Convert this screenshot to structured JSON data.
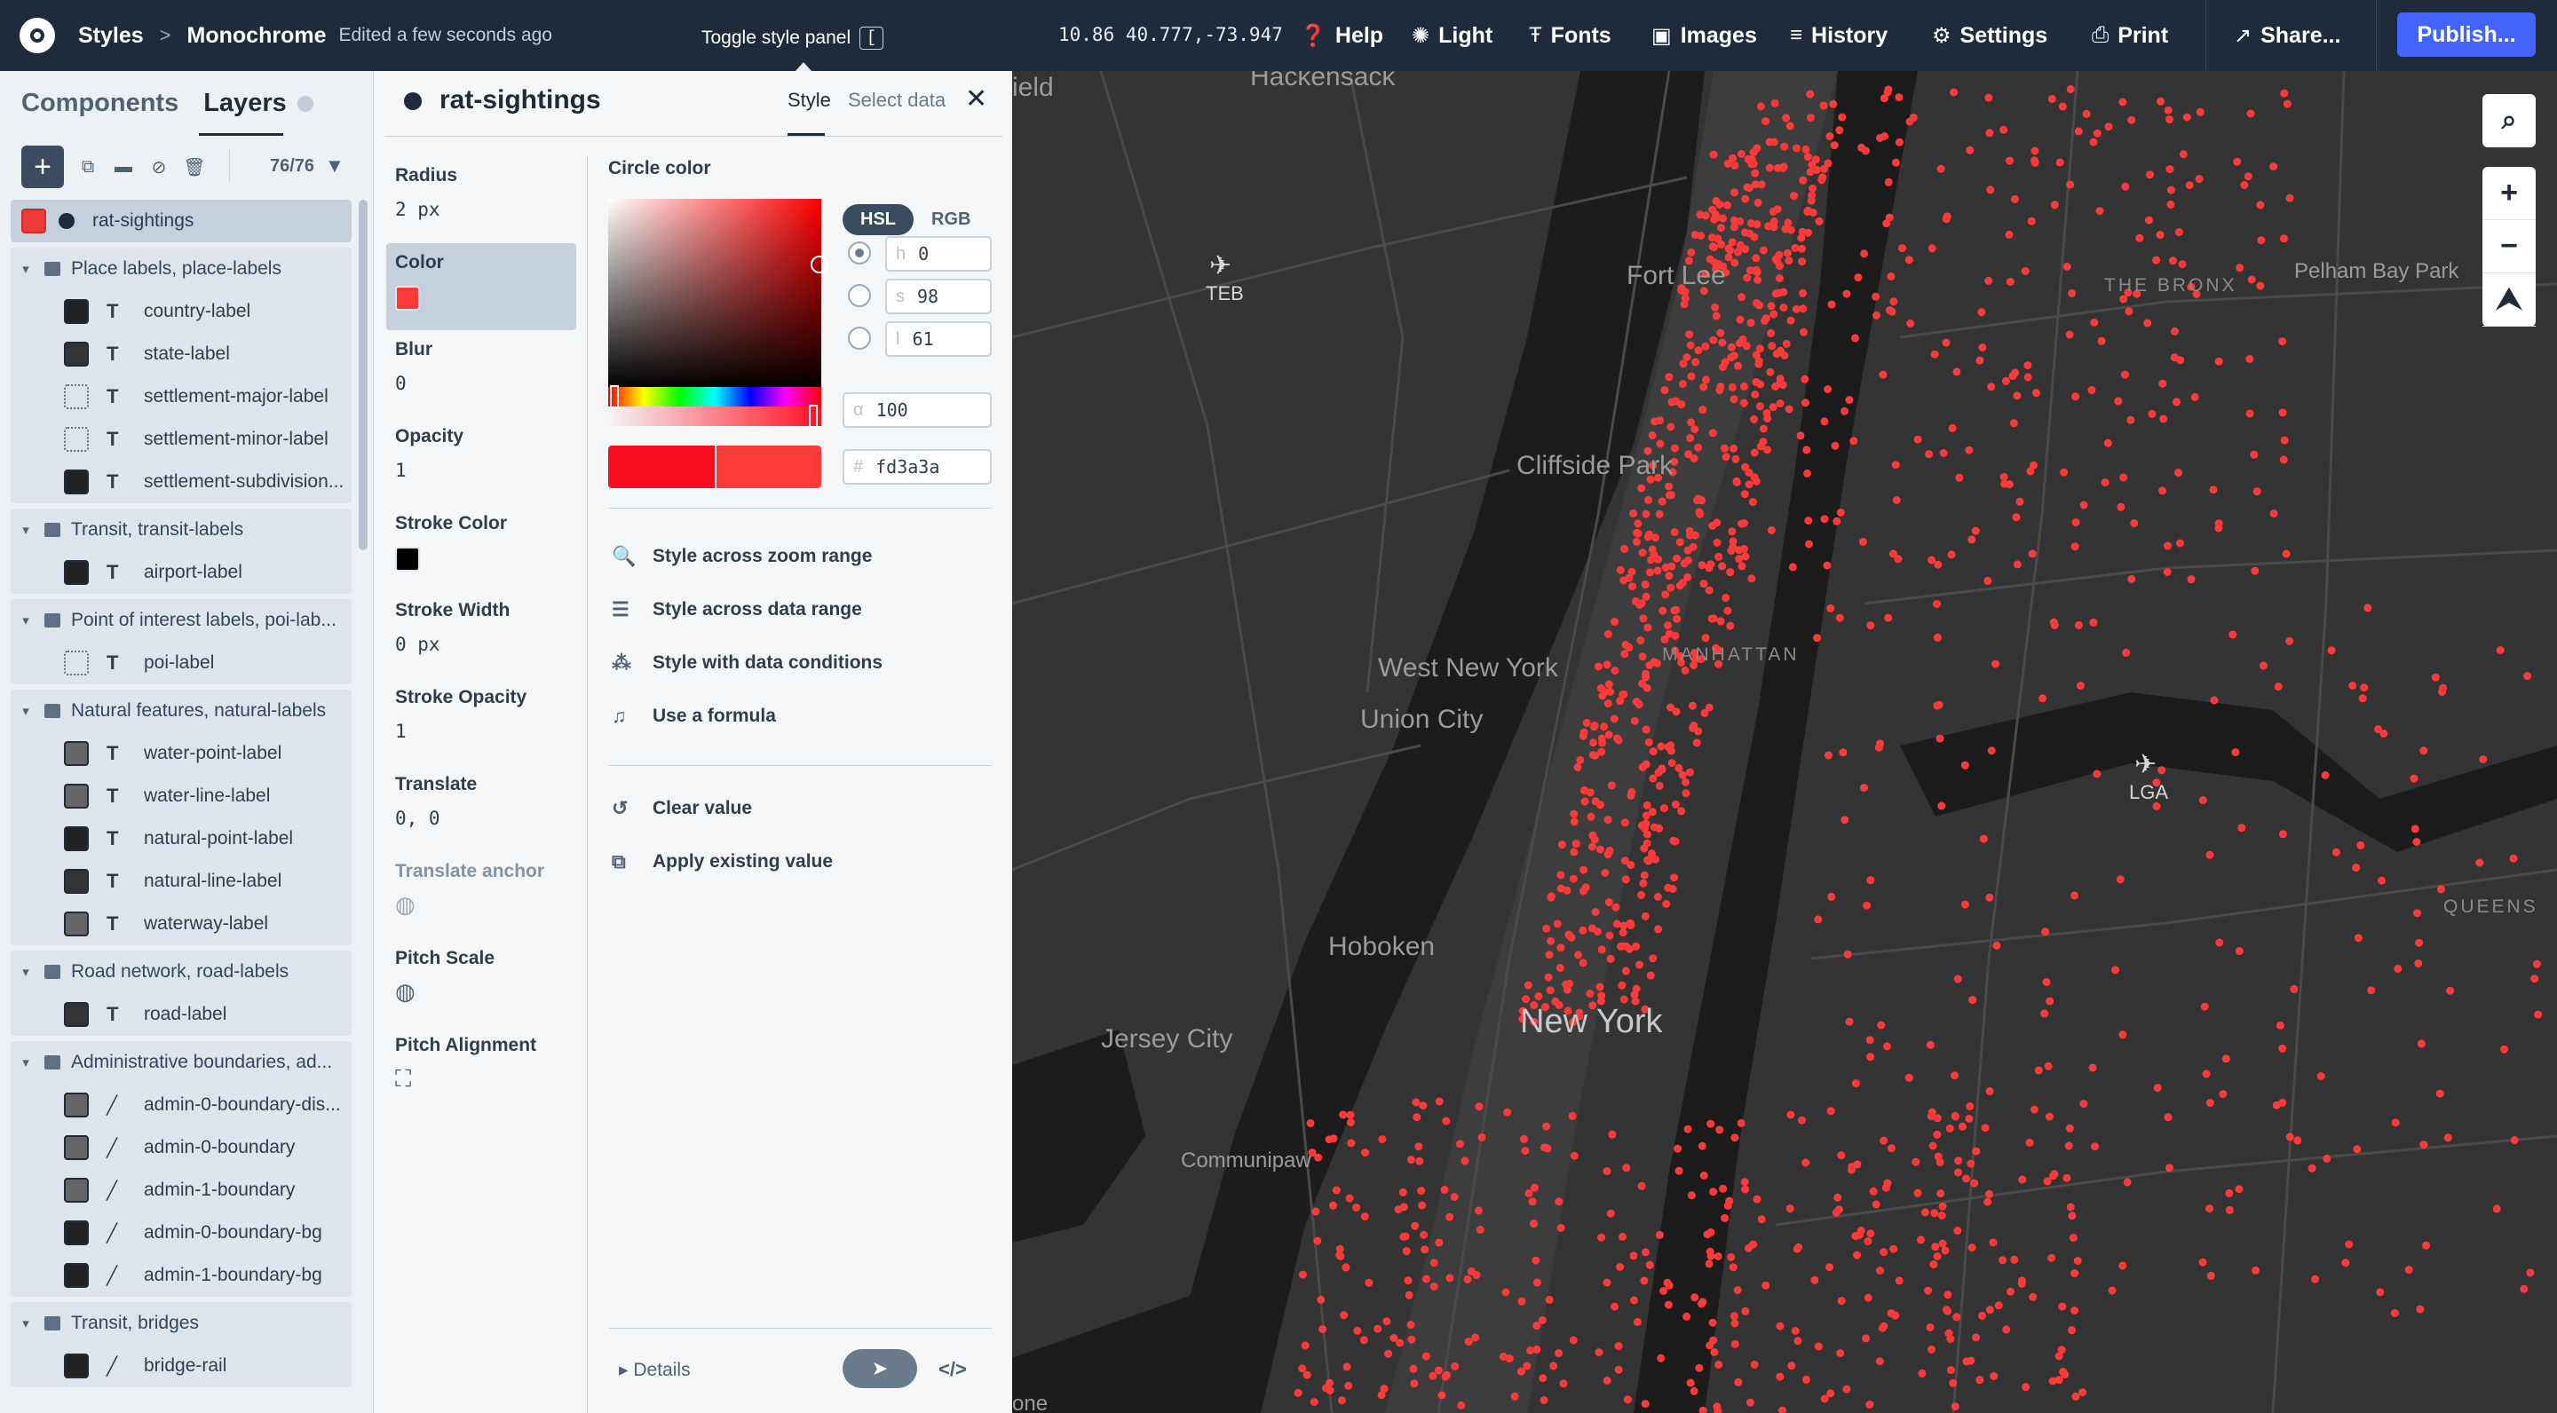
{
  "topbar": {
    "crumb": "Styles",
    "style_name": "Monochrome",
    "edited": "Edited a few seconds ago",
    "toggle_tip": "Toggle style panel",
    "toggle_key": "[",
    "coords": "10.86 40.777,-73.947",
    "menu": {
      "help": "Help",
      "light": "Light",
      "fonts": "Fonts",
      "images": "Images",
      "history": "History",
      "settings": "Settings",
      "print": "Print",
      "share": "Share...",
      "publish": "Publish..."
    }
  },
  "left_panel": {
    "tab_components": "Components",
    "tab_layers": "Layers",
    "layer_count": "76/76",
    "selected_layer": "rat-sightings",
    "groups": [
      {
        "name": "Place labels, place-labels",
        "layers": [
          {
            "name": "country-label",
            "type": "symbol",
            "swatch": "#222222"
          },
          {
            "name": "state-label",
            "type": "symbol",
            "swatch": "#333333"
          },
          {
            "name": "settlement-major-label",
            "type": "symbol",
            "swatch": "none"
          },
          {
            "name": "settlement-minor-label",
            "type": "symbol",
            "swatch": "none"
          },
          {
            "name": "settlement-subdivision...",
            "type": "symbol",
            "swatch": "#222222"
          }
        ]
      },
      {
        "name": "Transit, transit-labels",
        "layers": [
          {
            "name": "airport-label",
            "type": "symbol",
            "swatch": "#222222"
          }
        ]
      },
      {
        "name": "Point of interest labels, poi-lab...",
        "layers": [
          {
            "name": "poi-label",
            "type": "symbol",
            "swatch": "none"
          }
        ]
      },
      {
        "name": "Natural features, natural-labels",
        "layers": [
          {
            "name": "water-point-label",
            "type": "symbol",
            "swatch": "#666666"
          },
          {
            "name": "water-line-label",
            "type": "symbol",
            "swatch": "#666666"
          },
          {
            "name": "natural-point-label",
            "type": "symbol",
            "swatch": "#222222"
          },
          {
            "name": "natural-line-label",
            "type": "symbol",
            "swatch": "#333333"
          },
          {
            "name": "waterway-label",
            "type": "symbol",
            "swatch": "#666666"
          }
        ]
      },
      {
        "name": "Road network, road-labels",
        "layers": [
          {
            "name": "road-label",
            "type": "symbol",
            "swatch": "#333333"
          }
        ]
      },
      {
        "name": "Administrative boundaries, ad...",
        "layers": [
          {
            "name": "admin-0-boundary-dis...",
            "type": "line",
            "swatch": "#666666"
          },
          {
            "name": "admin-0-boundary",
            "type": "line",
            "swatch": "#666666"
          },
          {
            "name": "admin-1-boundary",
            "type": "line",
            "swatch": "#666666"
          },
          {
            "name": "admin-0-boundary-bg",
            "type": "line",
            "swatch": "#222222"
          },
          {
            "name": "admin-1-boundary-bg",
            "type": "line",
            "swatch": "#222222"
          }
        ]
      },
      {
        "name": "Transit, bridges",
        "layers": [
          {
            "name": "bridge-rail",
            "type": "line",
            "swatch": "#222222"
          }
        ]
      }
    ]
  },
  "style_panel": {
    "layer_name": "rat-sightings",
    "tab_style": "Style",
    "tab_select_data": "Select data",
    "props": [
      {
        "label": "Radius",
        "value": "2 px"
      },
      {
        "label": "Color",
        "value": ""
      },
      {
        "label": "Blur",
        "value": "0"
      },
      {
        "label": "Opacity",
        "value": "1"
      },
      {
        "label": "Stroke Color",
        "value": ""
      },
      {
        "label": "Stroke Width",
        "value": "0 px"
      },
      {
        "label": "Stroke Opacity",
        "value": "1"
      },
      {
        "label": "Translate",
        "value": "0, 0"
      },
      {
        "label": "Translate anchor",
        "value": ""
      },
      {
        "label": "Pitch Scale",
        "value": ""
      },
      {
        "label": "Pitch Alignment",
        "value": ""
      }
    ],
    "color_swatch": "#fd3a3a",
    "stroke_swatch": "#000000",
    "circle_color_title": "Circle color",
    "mode_hsl": "HSL",
    "mode_rgb": "RGB",
    "h_label": "h",
    "h_value": "0",
    "s_label": "s",
    "s_value": "98",
    "l_label": "l",
    "l_value": "61",
    "alpha_label": "α",
    "alpha_value": "100",
    "hex_label": "#",
    "hex_value": "fd3a3a",
    "actions": {
      "zoom_range": "Style across zoom range",
      "data_range": "Style across data range",
      "data_conditions": "Style with data conditions",
      "formula": "Use a formula",
      "clear": "Clear value",
      "apply_existing": "Apply existing value"
    },
    "details": "Details"
  },
  "map": {
    "labels": {
      "hackensack": "Hackensack",
      "fort_lee": "Fort Lee",
      "cliffside_park": "Cliffside Park",
      "west_new_york": "West New York",
      "union_city": "Union City",
      "hoboken": "Hoboken",
      "jersey_city": "Jersey City",
      "new_york": "New York",
      "communipaw": "Communipaw",
      "manhattan": "MANHATTAN",
      "the_bronx": "THE BRONX",
      "queens": "QUEENS",
      "pelham_bay_park": "Pelham Bay Park",
      "teb": "TEB",
      "lga": "LGA",
      "field": "ield",
      "bottom": "one"
    },
    "point_color": "#fd3a3a"
  }
}
